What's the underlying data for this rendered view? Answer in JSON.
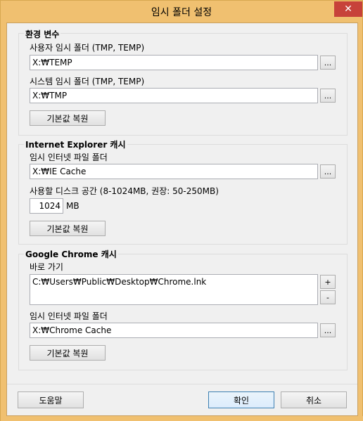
{
  "window": {
    "title": "임시 폴더 설정",
    "close_glyph": "✕"
  },
  "env": {
    "group_title": "환경 변수",
    "user_label": "사용자 임시 폴더 (TMP, TEMP)",
    "user_value": "X:₩TEMP",
    "system_label": "시스템 임시 폴더 (TMP, TEMP)",
    "system_value": "X:₩TMP",
    "browse": "...",
    "reset": "기본값 복원"
  },
  "ie": {
    "group_title": "Internet Explorer 캐시",
    "folder_label": "임시 인터넷 파일 폴더",
    "folder_value": "X:₩IE Cache",
    "disk_label": "사용할 디스크 공간 (8-1024MB, 권장: 50-250MB)",
    "disk_value": "1024",
    "disk_unit": "MB",
    "browse": "...",
    "reset": "기본값 복원"
  },
  "chrome": {
    "group_title": "Google Chrome 캐시",
    "shortcut_label": "바로 가기",
    "shortcut_value": "C:₩Users₩Public₩Desktop₩Chrome.lnk",
    "add": "+",
    "remove": "-",
    "folder_label": "임시 인터넷 파일 폴더",
    "folder_value": "X:₩Chrome Cache",
    "browse": "...",
    "reset": "기본값 복원"
  },
  "footer": {
    "help": "도움말",
    "ok": "확인",
    "cancel": "취소"
  }
}
